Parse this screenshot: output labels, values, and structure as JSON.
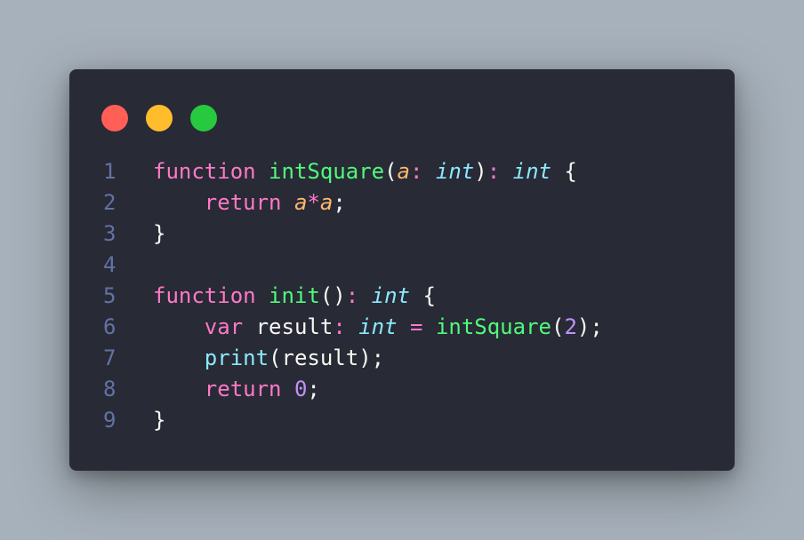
{
  "window": {
    "colors": {
      "background": "#282a36",
      "page": "#a7b1bb"
    },
    "traffic_lights": [
      {
        "name": "close",
        "color": "#ff5f56"
      },
      {
        "name": "minimize",
        "color": "#ffbd2e"
      },
      {
        "name": "maximize",
        "color": "#27c93f"
      }
    ]
  },
  "code": {
    "lines": [
      {
        "number": "1",
        "tokens": [
          {
            "t": "function",
            "c": "kw"
          },
          {
            "t": " ",
            "c": "plain"
          },
          {
            "t": "intSquare",
            "c": "fn"
          },
          {
            "t": "(",
            "c": "plain"
          },
          {
            "t": "a",
            "c": "param"
          },
          {
            "t": ":",
            "c": "op"
          },
          {
            "t": " ",
            "c": "plain"
          },
          {
            "t": "int",
            "c": "type"
          },
          {
            "t": ")",
            "c": "plain"
          },
          {
            "t": ":",
            "c": "op"
          },
          {
            "t": " ",
            "c": "plain"
          },
          {
            "t": "int",
            "c": "type"
          },
          {
            "t": " {",
            "c": "plain"
          }
        ]
      },
      {
        "number": "2",
        "tokens": [
          {
            "t": "    ",
            "c": "plain"
          },
          {
            "t": "return",
            "c": "kw"
          },
          {
            "t": " ",
            "c": "plain"
          },
          {
            "t": "a",
            "c": "param"
          },
          {
            "t": "*",
            "c": "op"
          },
          {
            "t": "a",
            "c": "param"
          },
          {
            "t": ";",
            "c": "plain"
          }
        ]
      },
      {
        "number": "3",
        "tokens": [
          {
            "t": "}",
            "c": "plain"
          }
        ]
      },
      {
        "number": "4",
        "tokens": []
      },
      {
        "number": "5",
        "tokens": [
          {
            "t": "function",
            "c": "kw"
          },
          {
            "t": " ",
            "c": "plain"
          },
          {
            "t": "init",
            "c": "fn"
          },
          {
            "t": "()",
            "c": "plain"
          },
          {
            "t": ":",
            "c": "op"
          },
          {
            "t": " ",
            "c": "plain"
          },
          {
            "t": "int",
            "c": "type"
          },
          {
            "t": " {",
            "c": "plain"
          }
        ]
      },
      {
        "number": "6",
        "tokens": [
          {
            "t": "    ",
            "c": "plain"
          },
          {
            "t": "var",
            "c": "kw"
          },
          {
            "t": " result",
            "c": "plain"
          },
          {
            "t": ":",
            "c": "op"
          },
          {
            "t": " ",
            "c": "plain"
          },
          {
            "t": "int",
            "c": "type"
          },
          {
            "t": " ",
            "c": "plain"
          },
          {
            "t": "=",
            "c": "op"
          },
          {
            "t": " ",
            "c": "plain"
          },
          {
            "t": "intSquare",
            "c": "fn"
          },
          {
            "t": "(",
            "c": "plain"
          },
          {
            "t": "2",
            "c": "num"
          },
          {
            "t": ");",
            "c": "plain"
          }
        ]
      },
      {
        "number": "7",
        "tokens": [
          {
            "t": "    ",
            "c": "plain"
          },
          {
            "t": "print",
            "c": "builtin"
          },
          {
            "t": "(result);",
            "c": "plain"
          }
        ]
      },
      {
        "number": "8",
        "tokens": [
          {
            "t": "    ",
            "c": "plain"
          },
          {
            "t": "return",
            "c": "kw"
          },
          {
            "t": " ",
            "c": "plain"
          },
          {
            "t": "0",
            "c": "num"
          },
          {
            "t": ";",
            "c": "plain"
          }
        ]
      },
      {
        "number": "9",
        "tokens": [
          {
            "t": "}",
            "c": "plain"
          }
        ]
      }
    ]
  }
}
